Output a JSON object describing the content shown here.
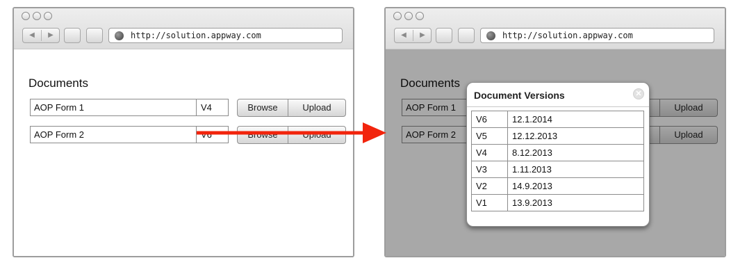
{
  "browser": {
    "url": "http://solution.appway.com"
  },
  "form": {
    "heading": "Documents",
    "rows": [
      {
        "name": "AOP Form 1",
        "version": "V4",
        "browse_label": "Browse",
        "upload_label": "Upload"
      },
      {
        "name": "AOP Form 2",
        "version": "V6",
        "browse_label": "Browse",
        "upload_label": "Upload"
      }
    ]
  },
  "dialog": {
    "title": "Document Versions",
    "close_glyph": "✕",
    "versions": [
      {
        "version": "V6",
        "date": "12.1.2014"
      },
      {
        "version": "V5",
        "date": "12.12.2013"
      },
      {
        "version": "V4",
        "date": "8.12.2013"
      },
      {
        "version": "V3",
        "date": "1.11.2013"
      },
      {
        "version": "V2",
        "date": "14.9.2013"
      },
      {
        "version": "V1",
        "date": "13.9.2013"
      }
    ]
  },
  "icons": {
    "nav_back": "◀",
    "nav_forward": "▶"
  },
  "colors": {
    "arrow": "#f2240c",
    "overlay": "rgba(0,0,0,0.34)"
  }
}
